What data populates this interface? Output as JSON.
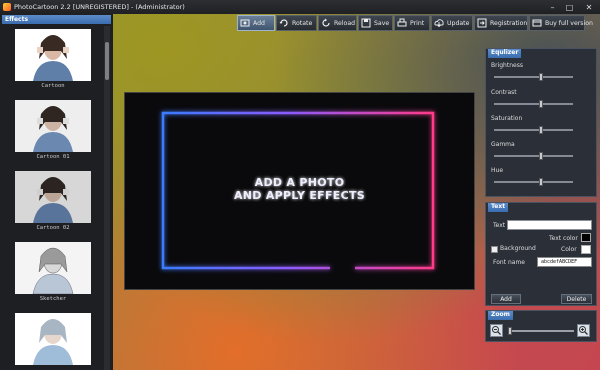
{
  "window": {
    "title": "PhotoCartoon 2.2 [UNREGISTERED] - (Administrator)",
    "minimize_icon": "minimize-icon",
    "maximize_icon": "maximize-icon",
    "close_icon": "close-icon"
  },
  "toolbar": {
    "items": [
      {
        "label": "Add",
        "icon": "add-photo-icon",
        "active": true
      },
      {
        "label": "Rotate",
        "icon": "rotate-icon"
      },
      {
        "label": "Reload",
        "icon": "reload-icon"
      },
      {
        "label": "Save",
        "icon": "save-icon"
      },
      {
        "label": "Print",
        "icon": "print-icon"
      },
      {
        "label": "Update",
        "icon": "update-icon"
      },
      {
        "label": "Registration",
        "icon": "registration-icon"
      },
      {
        "label": "Buy full version",
        "icon": "buy-icon"
      }
    ]
  },
  "effects": {
    "title": "Effects",
    "items": [
      {
        "label": "Cartoon"
      },
      {
        "label": "Cartoon 01"
      },
      {
        "label": "Cartoon 02"
      },
      {
        "label": "Sketcher"
      },
      {
        "label": ""
      }
    ]
  },
  "canvas": {
    "line1": "ADD A PHOTO",
    "line2": "AND APPLY EFFECTS"
  },
  "equalizer": {
    "title": "Equlizer",
    "sliders": [
      {
        "label": "Brightness",
        "value": 0.5
      },
      {
        "label": "Contrast",
        "value": 0.5
      },
      {
        "label": "Saturation",
        "value": 0.5
      },
      {
        "label": "Gamma",
        "value": 0.5
      },
      {
        "label": "Hue",
        "value": 0.5
      }
    ]
  },
  "text_panel": {
    "title": "Text",
    "text_label": "Text",
    "text_value": "",
    "text_color_label": "Text color",
    "text_color": "#000000",
    "background_label": "Background",
    "background_checked": false,
    "color_label": "Color",
    "bg_color": "#ffffff",
    "font_name_label": "Font name",
    "font_sample": "abcdefABCDEF",
    "add_label": "Add",
    "delete_label": "Delete"
  },
  "zoom": {
    "title": "Zoom",
    "zoom_out_icon": "zoom-out-icon",
    "zoom_in_icon": "zoom-in-icon",
    "value": 0.0
  }
}
